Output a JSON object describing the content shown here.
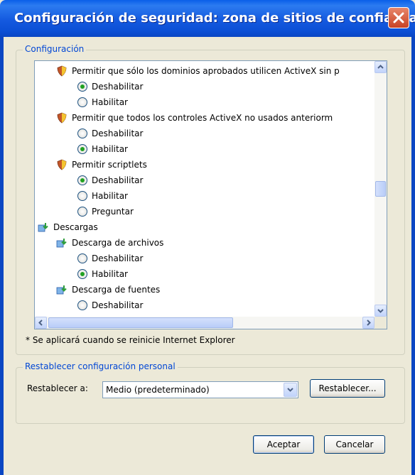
{
  "window": {
    "title": "Configuración de seguridad: zona de sitios de confianza"
  },
  "settings_group": {
    "legend": "Configuración"
  },
  "tree": [
    {
      "kind": "setting",
      "icon": "shield-icon",
      "label": "Permitir que sólo los dominios aprobados utilicen ActiveX sin p"
    },
    {
      "kind": "option",
      "label": "Deshabilitar",
      "checked": true
    },
    {
      "kind": "option",
      "label": "Habilitar",
      "checked": false
    },
    {
      "kind": "setting",
      "icon": "shield-icon",
      "label": "Permitir que todos los controles ActiveX no usados anteriorm"
    },
    {
      "kind": "option",
      "label": "Deshabilitar",
      "checked": false
    },
    {
      "kind": "option",
      "label": "Habilitar",
      "checked": true
    },
    {
      "kind": "setting",
      "icon": "shield-icon",
      "label": "Permitir scriptlets"
    },
    {
      "kind": "option",
      "label": "Deshabilitar",
      "checked": true
    },
    {
      "kind": "option",
      "label": "Habilitar",
      "checked": false
    },
    {
      "kind": "option",
      "label": "Preguntar",
      "checked": false
    },
    {
      "kind": "category",
      "icon": "download-icon",
      "label": "Descargas"
    },
    {
      "kind": "subcategory",
      "icon": "download-icon",
      "label": "Descarga de archivos"
    },
    {
      "kind": "option",
      "label": "Deshabilitar",
      "checked": false
    },
    {
      "kind": "option",
      "label": "Habilitar",
      "checked": true
    },
    {
      "kind": "subcategory",
      "icon": "download-icon",
      "label": "Descarga de fuentes"
    },
    {
      "kind": "option",
      "label": "Deshabilitar",
      "checked": false
    }
  ],
  "note": "* Se aplicará cuando se reinicie Internet Explorer",
  "reset_group": {
    "legend": "Restablecer configuración personal",
    "label": "Restablecer a:",
    "selected": "Medio (predeterminado)",
    "reset_button": "Restablecer..."
  },
  "buttons": {
    "ok": "Aceptar",
    "cancel": "Cancelar"
  },
  "colors": {
    "accent": "#0046D5",
    "title_bar": "#0A5FE8",
    "checked_radio": "#21A121"
  }
}
